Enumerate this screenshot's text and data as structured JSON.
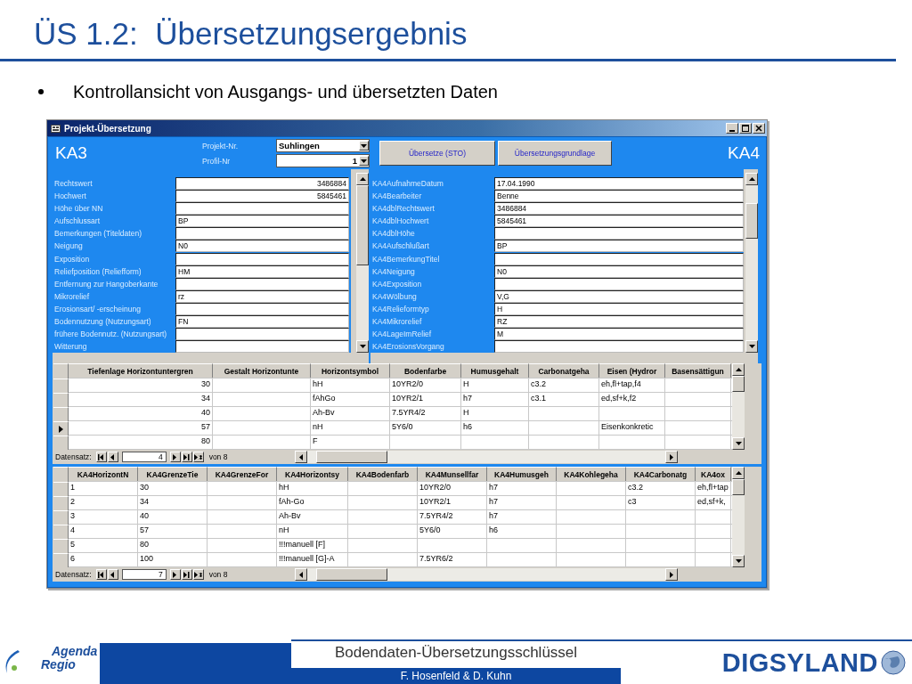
{
  "slide": {
    "title": "ÜS 1.2:  Übersetzungsergebnis",
    "bullet": "Kontrollansicht von Ausgangs- und übersetzten Daten"
  },
  "window": {
    "title": "Projekt-Übersetzung",
    "left_heading": "KA3",
    "right_heading": "KA4",
    "project_label": "Projekt-Nr.",
    "project_value": "Suhlingen",
    "profile_label": "Profil-Nr",
    "profile_value": "1",
    "buttons": [
      "Übersetze (STO)",
      "Übersetzungsgrundlage"
    ]
  },
  "left_fields": [
    {
      "label": "Rechtswert",
      "value": "3486884",
      "kind": "number"
    },
    {
      "label": "Hochwert",
      "value": "5845461",
      "kind": "number"
    },
    {
      "label": "Höhe über NN",
      "kind": "text"
    },
    {
      "label": "Aufschlussart",
      "value": "BP",
      "kind": "text"
    },
    {
      "label": "Bemerkungen (Titeldaten)",
      "kind": "text"
    },
    {
      "label": "Neigung",
      "value": "N0",
      "kind": "text"
    },
    {
      "label": "Exposition",
      "kind": "text"
    },
    {
      "label": "Reliefposition (Reliefform)",
      "value": "HM",
      "kind": "text"
    },
    {
      "label": "Entfernung zur Hangoberkante",
      "kind": "text"
    },
    {
      "label": "Mikrorelief",
      "value": "rz",
      "kind": "text"
    },
    {
      "label": "Erosionsart/ -erscheinung",
      "kind": "text"
    },
    {
      "label": "Bodennutzung (Nutzungsart)",
      "value": "FN",
      "kind": "text"
    },
    {
      "label": "frühere Bodennutz. (Nutzungsart)",
      "kind": "text"
    },
    {
      "label": "Witterung",
      "kind": "text"
    }
  ],
  "right_fields": [
    {
      "label": "KA4AufnahmeDatum",
      "value": "17.04.1990"
    },
    {
      "label": "KA4Bearbeiter",
      "value": "Benne"
    },
    {
      "label": "KA4dblRechtswert",
      "value": "3486884"
    },
    {
      "label": "KA4dblHochwert",
      "value": "5845461"
    },
    {
      "label": "KA4dblHöhe"
    },
    {
      "label": "KA4Aufschlußart",
      "value": "BP"
    },
    {
      "label": "KA4BemerkungTitel"
    },
    {
      "label": "KA4Neigung",
      "value": "N0"
    },
    {
      "label": "KA4Exposition"
    },
    {
      "label": "KA4Wölbung",
      "value": "V,G"
    },
    {
      "label": "KA4Relieformtyp",
      "value": "H"
    },
    {
      "label": "KA4Mikrorelief",
      "value": "RZ"
    },
    {
      "label": "KA4LageImRelief",
      "value": "M"
    },
    {
      "label": "KA4ErosionsVorgang"
    }
  ],
  "ka3_table": {
    "columns": [
      {
        "label": "Tiefenlage Horizontuntergren",
        "kind": "number"
      },
      {
        "label": "Gestalt Horizontunte",
        "kind": "text"
      },
      {
        "label": "Horizontsymbol",
        "kind": "text"
      },
      {
        "label": "Bodenfarbe",
        "kind": "text"
      },
      {
        "label": "Humusgehalt",
        "kind": "text"
      },
      {
        "label": "Carbonatgeha",
        "kind": "text"
      },
      {
        "label": "Eisen (Hydror",
        "kind": "text"
      },
      {
        "label": "Basensättigun",
        "kind": "text"
      }
    ],
    "rows": [
      {
        "selected": false,
        "cells": [
          "30",
          "",
          "hH",
          "10YR2/0",
          "H",
          "c3.2",
          "eh,fl+tap,f4",
          ""
        ]
      },
      {
        "selected": false,
        "cells": [
          "34",
          "",
          "fAhGo",
          "10YR2/1",
          "h7",
          "c3.1",
          "ed,sf+k,f2",
          ""
        ]
      },
      {
        "selected": false,
        "cells": [
          "40",
          "",
          "Ah-Bv",
          "7.5YR4/2",
          "H",
          "",
          "",
          ""
        ]
      },
      {
        "selected": true,
        "cells": [
          "57",
          "",
          "nH",
          "5Y6/0",
          "h6",
          "",
          "Eisenkonkretic",
          ""
        ]
      },
      {
        "selected": false,
        "cells": [
          "80",
          "",
          "F",
          "",
          "",
          "",
          "",
          ""
        ]
      }
    ],
    "nav_label": "Datensatz:",
    "record": "4",
    "total": "von 8"
  },
  "ka4_table": {
    "columns": [
      {
        "label": "KA4HorizontN"
      },
      {
        "label": "KA4GrenzeTie"
      },
      {
        "label": "KA4GrenzeFor"
      },
      {
        "label": "KA4Horizontsy"
      },
      {
        "label": "KA4Bodenfarb"
      },
      {
        "label": "KA4Munsellfar"
      },
      {
        "label": "KA4Humusgeh"
      },
      {
        "label": "KA4Kohlegeha"
      },
      {
        "label": "KA4Carbonatg"
      },
      {
        "label": "KA4ox"
      }
    ],
    "rows": [
      {
        "selected": false,
        "cells": [
          "1",
          "30",
          "",
          "hH",
          "",
          "10YR2/0",
          "h7",
          "",
          "c3.2",
          "eh,fl+tap"
        ]
      },
      {
        "selected": false,
        "cells": [
          "2",
          "34",
          "",
          "fAh-Go",
          "",
          "10YR2/1",
          "h7",
          "",
          "c3",
          "ed,sf+k,"
        ]
      },
      {
        "selected": false,
        "cells": [
          "3",
          "40",
          "",
          "Ah-Bv",
          "",
          "7.5YR4/2",
          "h7",
          "",
          "",
          ""
        ]
      },
      {
        "selected": false,
        "cells": [
          "4",
          "57",
          "",
          "nH",
          "",
          "5Y6/0",
          "h6",
          "",
          "",
          ""
        ]
      },
      {
        "selected": false,
        "cells": [
          "5",
          "80",
          "",
          "!!!manuell [F]",
          "",
          "",
          "",
          "",
          "",
          ""
        ]
      },
      {
        "selected": false,
        "cells": [
          "6",
          "100",
          "",
          "!!!manuell [G]-A",
          "",
          "7.5YR6/2",
          "",
          "",
          "",
          ""
        ]
      }
    ],
    "nav_label": "Datensatz:",
    "record": "7",
    "total": "von 8"
  },
  "footer": {
    "logo_top": "Agenda",
    "logo_bottom": "Regio",
    "title": "Bodendaten-Übersetzungsschlüssel",
    "authors": "F. Hosenfeld & D. Kuhn",
    "brand": "DIGSYLAND"
  }
}
